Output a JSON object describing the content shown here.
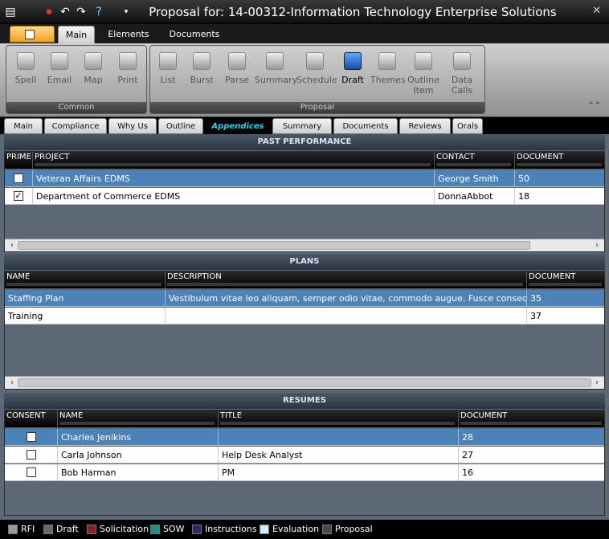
{
  "window": {
    "title": "Proposal for: 14-00312-Information Technology Enterprise Solutions"
  },
  "ribbon_tabs": [
    {
      "label": "Main"
    },
    {
      "label": "Elements"
    },
    {
      "label": "Documents"
    }
  ],
  "ribbon": {
    "common": {
      "label": "Common",
      "buttons": [
        "Spell",
        "Email",
        "Map",
        "Print"
      ]
    },
    "proposal": {
      "label": "Proposal",
      "buttons": [
        "List",
        "Burst",
        "Parse",
        "Summary",
        "Schedule",
        "Draft",
        "Themes",
        "Outline Item",
        "Data Calls"
      ]
    }
  },
  "page_tabs": [
    "Main",
    "Compliance",
    "Why Us",
    "Outline",
    "Appendices",
    "Summary",
    "Documents",
    "Reviews",
    "Orals"
  ],
  "past_performance": {
    "title": "PAST PERFORMANCE",
    "columns": [
      "PRIME",
      "PROJECT",
      "CONTACT",
      "DOCUMENT"
    ],
    "rows": [
      {
        "prime": false,
        "project": "Veteran Affairs EDMS",
        "contact": "George Smith",
        "document": "50"
      },
      {
        "prime": true,
        "project": "Department of Commerce EDMS",
        "contact": "DonnaAbbot",
        "document": "18"
      }
    ]
  },
  "plans": {
    "title": "PLANS",
    "columns": [
      "NAME",
      "DESCRIPTION",
      "DOCUMENT"
    ],
    "rows": [
      {
        "name": "Staffing Plan",
        "description": "Vestibulum vitae leo aliquam, semper odio vitae, commodo augue. Fusce consequat nunc s...",
        "document": "35"
      },
      {
        "name": "Training",
        "description": "",
        "document": "37"
      }
    ]
  },
  "resumes": {
    "title": "RESUMES",
    "columns": [
      "CONSENT",
      "NAME",
      "TITLE",
      "DOCUMENT"
    ],
    "rows": [
      {
        "consent": false,
        "name": "Charles Jenlkins",
        "title": "",
        "document": "28"
      },
      {
        "consent": false,
        "name": "Carla Johnson",
        "title": "Help Desk Analyst",
        "document": "27"
      },
      {
        "consent": false,
        "name": "Bob Harman",
        "title": "PM",
        "document": "16"
      }
    ]
  },
  "legend": [
    {
      "label": "RFI",
      "color": "#9a9a9a"
    },
    {
      "label": "Draft",
      "color": "#6a6a6a"
    },
    {
      "label": "Solicitation",
      "color": "#8b1e2b"
    },
    {
      "label": "SOW",
      "color": "#1f8f88"
    },
    {
      "label": "Instructions",
      "color": "#2b2b6a"
    },
    {
      "label": "Evaluation",
      "color": "#cdeef8"
    },
    {
      "label": "Proposal",
      "color": "#4a4a4a"
    }
  ]
}
